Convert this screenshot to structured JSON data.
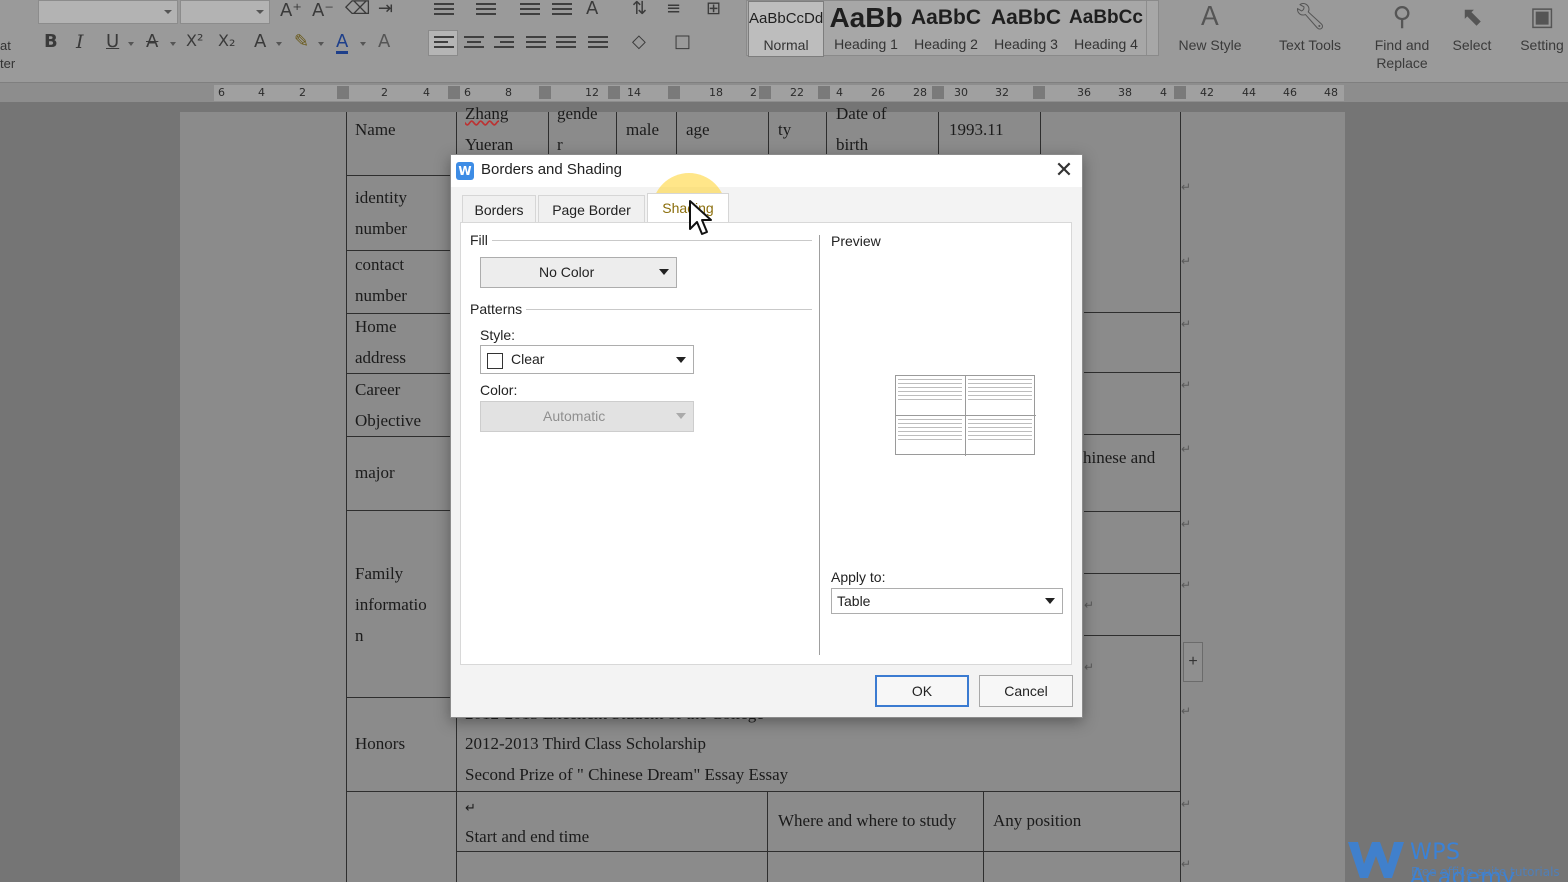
{
  "ribbon": {
    "left_labels": [
      "at",
      "ter"
    ],
    "font_buttons": {
      "grow": "A⁺",
      "shrink": "A⁻",
      "bold": "B",
      "italic": "I",
      "underline": "U",
      "strike": "A",
      "superscript": "X²",
      "subscript": "X₂",
      "font_color": "A",
      "char_shading": "A"
    },
    "styles": [
      {
        "sample": "AaBbCcDd",
        "label": "Normal"
      },
      {
        "sample": "AaBb",
        "label": "Heading 1"
      },
      {
        "sample": "AaBbC",
        "label": "Heading 2"
      },
      {
        "sample": "AaBbC",
        "label": "Heading 3"
      },
      {
        "sample": "AaBbCc",
        "label": "Heading 4"
      }
    ],
    "tools": {
      "new_style": "New Style",
      "text_tools": "Text Tools",
      "find_replace_1": "Find and",
      "find_replace_2": "Replace",
      "select": "Select",
      "settings": "Setting"
    }
  },
  "ruler": {
    "numbers": [
      "6",
      "4",
      "2",
      "2",
      "4",
      "6",
      "8",
      "12",
      "14",
      "18",
      "2",
      "22",
      "4",
      "26",
      "28",
      "30",
      "32",
      "36",
      "38",
      "4",
      "42",
      "44",
      "46",
      "48"
    ]
  },
  "document": {
    "row1": {
      "name": "Name",
      "value1": "Zhang",
      "value2": "Yueran",
      "gender1": "gende",
      "gender2": "r",
      "male": "male",
      "age": "age",
      "ty": "ty",
      "dob1": "Date of",
      "dob2": "birth",
      "date": "1993.11"
    },
    "identity1": "identity",
    "identity2": "number",
    "contact1": "contact",
    "contact2": "number",
    "home1": "Home",
    "home2": "address",
    "career1": "Career",
    "career2": "Objective",
    "major": "major",
    "major_tail": "hinese and",
    "family1": "Family",
    "family2": "informatio",
    "family3": "n",
    "honors": "Honors",
    "honor_hidden": "2012-2013 Excellent Student of the College",
    "honor2": "2012-2013 Third Class Scholarship",
    "honor3": "Second Prize of \" Chinese Dream\" Essay Essay",
    "study_time": "Start and end time",
    "study_where": "Where and where to study",
    "study_position": "Any position",
    "para_mark": "↵"
  },
  "dialog": {
    "title": "Borders and Shading",
    "app_icon_letter": "W",
    "close": "✕",
    "tabs": [
      "Borders",
      "Page Border",
      "Shading"
    ],
    "active_tab": "Shading",
    "fill": {
      "label": "Fill",
      "value": "No Color"
    },
    "patterns": {
      "label": "Patterns",
      "style_label": "Style:",
      "style_value": "Clear",
      "color_label": "Color:",
      "color_value": "Automatic"
    },
    "preview_label": "Preview",
    "apply_to_label": "Apply to:",
    "apply_to_value": "Table",
    "ok": "OK",
    "cancel": "Cancel"
  },
  "watermark": {
    "title": "WPS Academy",
    "subtitle": "Free office suite tutorials"
  },
  "colors": {
    "highlight": "#ffd228",
    "accent": "#3b82d6",
    "active_tab_text": "#8a6d0a"
  }
}
